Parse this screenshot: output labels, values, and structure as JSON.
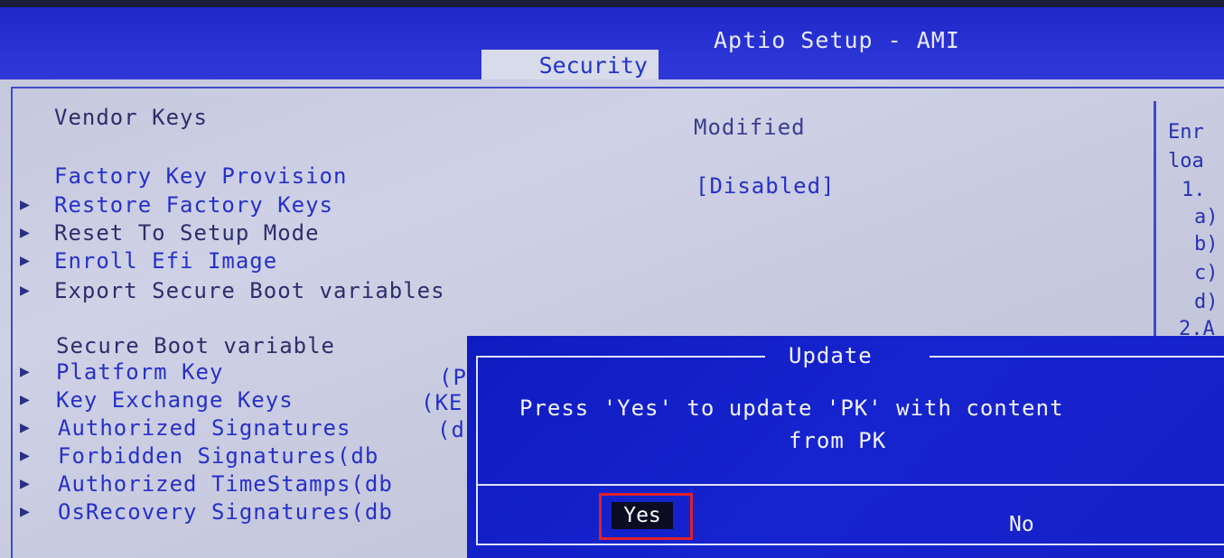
{
  "header": {
    "app_title": "Aptio Setup - AMI",
    "active_tab": "Security"
  },
  "main": {
    "vendor_keys_label": "Vendor Keys",
    "vendor_keys_value": "Modified",
    "factory_key_provision_label": "Factory Key Provision",
    "factory_key_provision_value": "[Disabled]",
    "menu_items": [
      "Restore Factory Keys",
      "Reset To Setup Mode",
      "Enroll Efi Image",
      "Export Secure Boot variables"
    ],
    "secure_boot_variable_label": "Secure Boot variable",
    "variable_items": [
      {
        "label": "Platform Key",
        "value_fragment": "(P"
      },
      {
        "label": "Key Exchange Keys",
        "value_fragment": "(KE"
      },
      {
        "label": "Authorized Signatures",
        "value_fragment": "(d"
      },
      {
        "label": "Forbidden  Signatures(db",
        "value_fragment": ""
      },
      {
        "label": "Authorized TimeStamps(db",
        "value_fragment": ""
      },
      {
        "label": "OsRecovery Signatures(db",
        "value_fragment": ""
      }
    ]
  },
  "help_panel": {
    "lines": [
      "Enr",
      "loa",
      "1.",
      "a)",
      "b)",
      "c)",
      "d)",
      "2.A"
    ]
  },
  "dialog": {
    "title": "Update",
    "message_line1": "Press 'Yes' to update 'PK' with content",
    "message_line2": "from PK",
    "yes_label": "Yes",
    "no_label": "No"
  },
  "colors": {
    "bios_blue": "#1624cf",
    "highlight_red": "#e0202b"
  }
}
